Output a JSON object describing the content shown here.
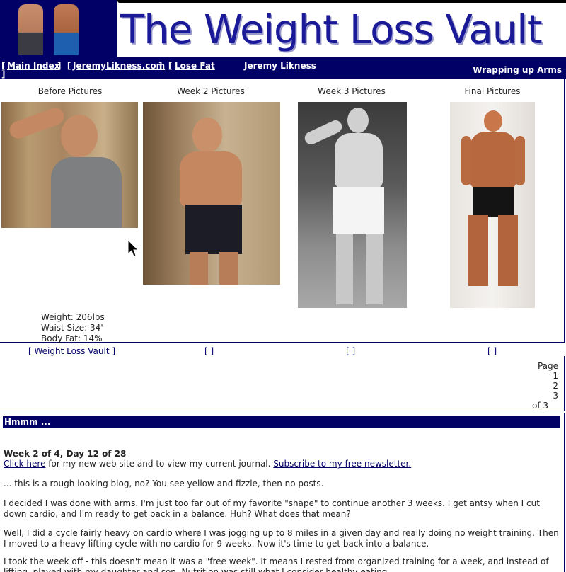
{
  "header": {
    "title": "The Weight Loss Vault",
    "colors": {
      "navy": "#000066",
      "title_blue": "#1a1a99"
    }
  },
  "nav": {
    "open_bracket": "[",
    "close_bracket": "]",
    "main_index": "Main Index",
    "jeremylikness": "JeremyLikness.com",
    "lose_fat": "Lose Fat",
    "author": "Jeremy Likness",
    "page_title": "Wrapping up Arms"
  },
  "pictures": {
    "captions": [
      "Before Pictures",
      "Week 2 Pictures",
      "Week 3 Pictures",
      "Final Pictures"
    ],
    "stats": {
      "weight": "Weight: 206lbs",
      "waist": "Waist Size: 34'",
      "body_fat": "Body Fat: 14%"
    }
  },
  "links": {
    "vault": "[ Weight Loss Vault ]",
    "empty": "[ ]"
  },
  "pager": {
    "label": "Page",
    "pages": [
      "1",
      "2",
      "3"
    ],
    "of": "of 3"
  },
  "blog": {
    "post_title": "Hmmm ...",
    "subtitle": "Week 2 of 4, Day 12 of 28",
    "click_here": "Click here",
    "click_here_rest": " for my new web site and to view my current journal. ",
    "subscribe": "Subscribe to my free newsletter.",
    "p1": "... this is a rough looking blog, no? You see yellow and fizzle, then no posts.",
    "p2": "I decided I was done with arms. I'm just too far out of my favorite \"shape\" to continue another 3 weeks. I get antsy when I cut down cardio, and I'm ready to get back in a balance. Huh? What does that mean?",
    "p3": "Well, I did a cycle fairly heavy on cardio where I was jogging up to 8 miles in a given day and really doing no weight training. Then I moved to a heavy lifting cycle with no cardio for 9 weeks. Now it's time to get back into a balance.",
    "p4": "I took the week off - this doesn't mean it was a \"free week\". It means I rested from organized training for a week, and instead of lifting, played with my daughter and son. Nutrition was still what I consider healthy eating."
  }
}
